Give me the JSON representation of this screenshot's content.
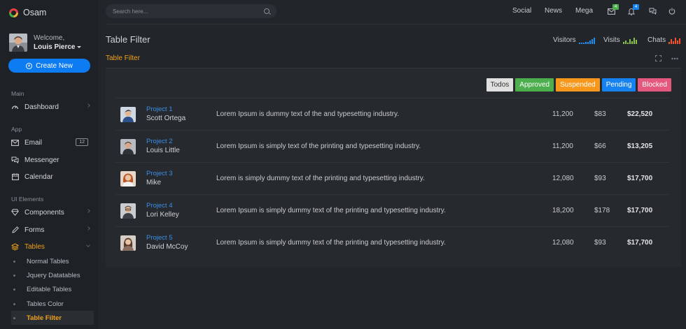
{
  "app": {
    "name": "Osam"
  },
  "user": {
    "welcome": "Welcome,",
    "name": "Louis Pierce"
  },
  "sidebar": {
    "create_label": "Create New",
    "sections": [
      "Main",
      "App",
      "UI Elements"
    ],
    "main_items": [
      {
        "label": "Dashboard",
        "icon": "dashboard-icon"
      }
    ],
    "app_items": [
      {
        "label": "Email",
        "icon": "mail-icon",
        "badge": "12"
      },
      {
        "label": "Messenger",
        "icon": "chat-icon"
      },
      {
        "label": "Calendar",
        "icon": "calendar-icon"
      }
    ],
    "ui_items": [
      {
        "label": "Components",
        "icon": "diamond-icon"
      },
      {
        "label": "Forms",
        "icon": "pencil-icon"
      },
      {
        "label": "Tables",
        "icon": "layers-icon"
      }
    ],
    "table_sub": [
      "Normal Tables",
      "Jquery Datatables",
      "Editable Tables",
      "Tables Color",
      "Table Filter"
    ]
  },
  "header": {
    "search_placeholder": "Search here...",
    "nav": [
      "Social",
      "News",
      "Mega"
    ],
    "mail_badge": "4",
    "bell_badge": "4"
  },
  "page": {
    "title": "Table Filter",
    "stats": [
      "Visitors",
      "Visits",
      "Chats"
    ]
  },
  "colors": {
    "accent": "#f0a11a",
    "primary": "#0d7bf2",
    "visitors": "#1f8ef1",
    "visits": "#8bc34a",
    "chats": "#f0532b"
  },
  "card": {
    "title": "Table Filter",
    "filters": [
      {
        "label": "Todos",
        "color": "#e0e0e0"
      },
      {
        "label": "Approved",
        "color": "#4cae4c"
      },
      {
        "label": "Suspended",
        "color": "#f7981c"
      },
      {
        "label": "Pending",
        "color": "#1582ef"
      },
      {
        "label": "Blocked",
        "color": "#e4577e"
      }
    ],
    "rows": [
      {
        "project": "Project 1",
        "name": "Scott Ortega",
        "desc": "Lorem Ipsum is dummy text of the and typesetting industry.",
        "qty": "11,200",
        "price": "$83",
        "total": "$22,520"
      },
      {
        "project": "Project 2",
        "name": "Louis Little",
        "desc": "Lorem Ipsum is simply text of the printing and typesetting industry.",
        "qty": "11,200",
        "price": "$66",
        "total": "$13,205"
      },
      {
        "project": "Project 3",
        "name": "Mike",
        "desc": "Lorem is simply dummy text of the printing and typesetting industry.",
        "qty": "12,080",
        "price": "$93",
        "total": "$17,700"
      },
      {
        "project": "Project 4",
        "name": "Lori Kelley",
        "desc": "Lorem Ipsum is simply dummy text of the printing and typesetting industry.",
        "qty": "18,200",
        "price": "$178",
        "total": "$17,700"
      },
      {
        "project": "Project 5",
        "name": "David McCoy",
        "desc": "Lorem Ipsum is simply dummy text of the printing and typesetting industry.",
        "qty": "12,080",
        "price": "$93",
        "total": "$17,700"
      }
    ]
  }
}
